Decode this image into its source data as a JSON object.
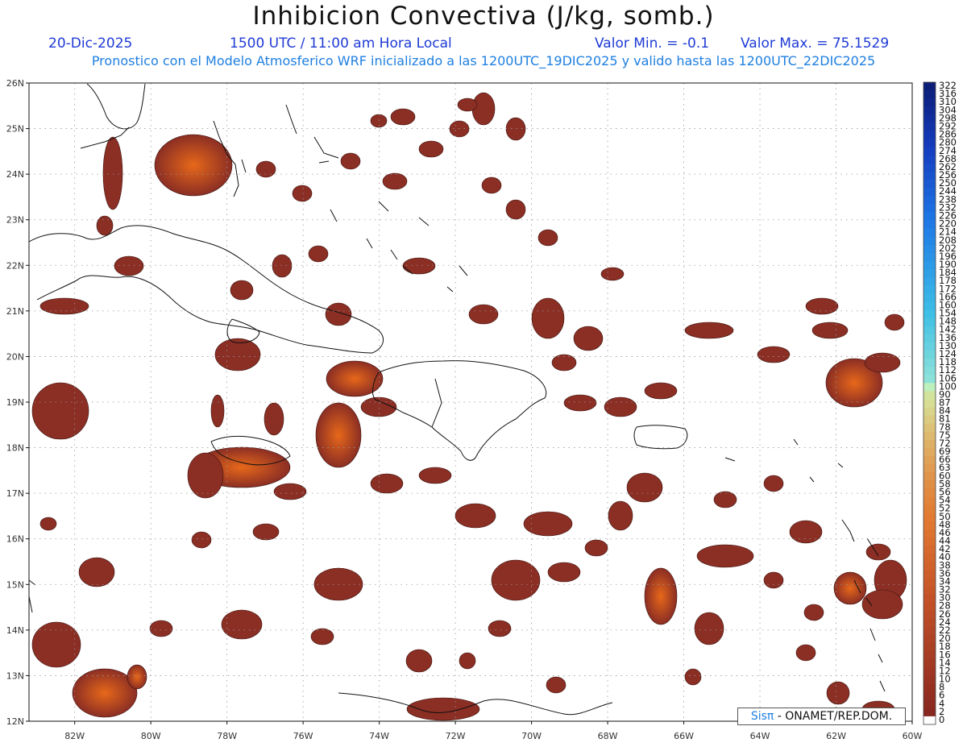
{
  "title": "Inhibicion Convectiva (J/kg, somb.)",
  "date": "20-Dic-2025",
  "time_label": "1500 UTC / 11:00 am Hora Local",
  "valor_min": "Valor Min. = -0.1",
  "valor_max": "Valor Max. = 75.1529",
  "forecast_line": "Pronostico con el Modelo Atmosferico WRF inicializado a las 1200UTC_19DIC2025 y valido hasta las  1200UTC_22DIC2025",
  "credit": {
    "brand": "Sisπ",
    "text": " - ONAMET/REP.DOM."
  },
  "map": {
    "projection": "lat-lon",
    "lon_range": [
      -83.2,
      -60.0
    ],
    "lat_range": [
      12.0,
      26.0
    ],
    "lon_ticks": [
      "82W",
      "80W",
      "78W",
      "76W",
      "74W",
      "72W",
      "70W",
      "68W",
      "66W",
      "64W",
      "62W",
      "60W"
    ],
    "lat_ticks": [
      "12N",
      "13N",
      "14N",
      "15N",
      "16N",
      "17N",
      "18N",
      "19N",
      "20N",
      "21N",
      "22N",
      "23N",
      "24N",
      "25N",
      "26N"
    ],
    "grid": "dotted",
    "field_color": "#8b2e24",
    "field_max_color": "#e7681a",
    "field_note": "scattered CIN cells 0-75 J/kg"
  },
  "legend": {
    "values": [
      "322",
      "316",
      "310",
      "304",
      "298",
      "292",
      "286",
      "280",
      "274",
      "268",
      "262",
      "256",
      "250",
      "244",
      "238",
      "232",
      "226",
      "220",
      "214",
      "208",
      "202",
      "196",
      "190",
      "184",
      "178",
      "172",
      "166",
      "160",
      "154",
      "148",
      "142",
      "136",
      "130",
      "124",
      "118",
      "112",
      "106",
      "100",
      "90",
      "87",
      "84",
      "81",
      "78",
      "75",
      "72",
      "69",
      "66",
      "63",
      "60",
      "58",
      "56",
      "54",
      "52",
      "50",
      "48",
      "46",
      "44",
      "42",
      "40",
      "38",
      "36",
      "34",
      "32",
      "30",
      "28",
      "26",
      "24",
      "22",
      "20",
      "18",
      "16",
      "14",
      "12",
      "10",
      "8",
      "6",
      "4",
      "2",
      "0"
    ]
  }
}
